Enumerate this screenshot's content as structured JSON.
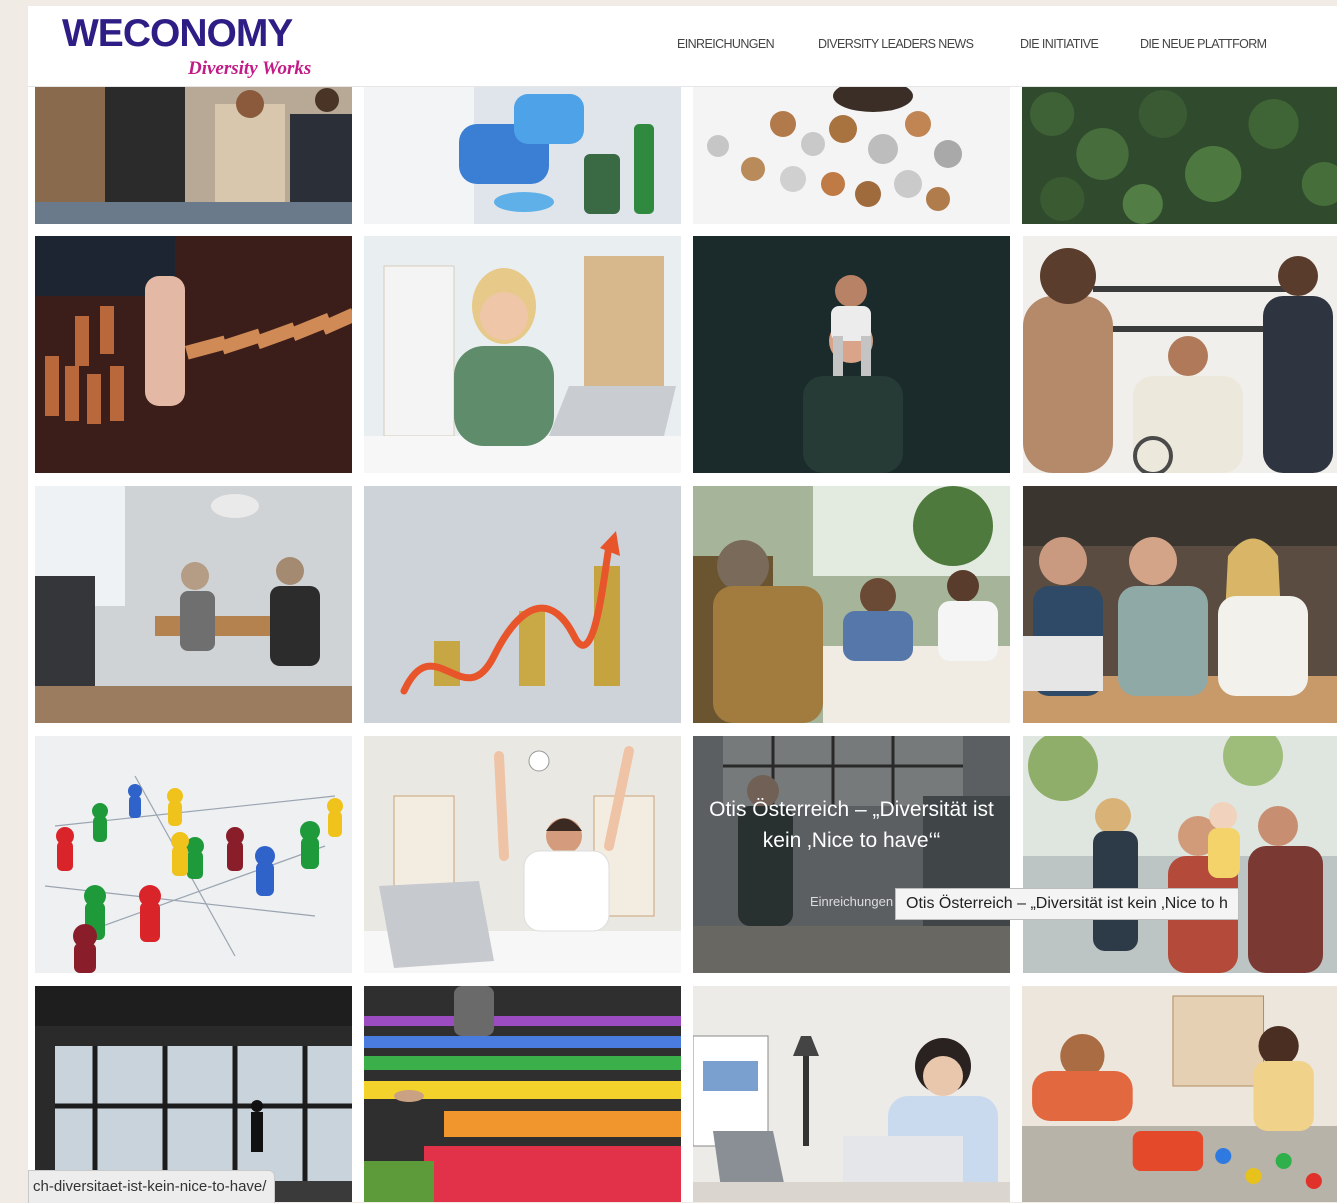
{
  "header": {
    "logo_main": "WECONOMY",
    "logo_sub": "Diversity Works",
    "nav": [
      "EINREICHUNGEN",
      "DIVERSITY LEADERS NEWS",
      "DIE INITIATIVE",
      "DIE NEUE PLATTFORM"
    ]
  },
  "hover_card": {
    "title": "Otis Österreich – „Diversität ist kein ‚Nice to have‘“",
    "category": "Einreichungen"
  },
  "tooltip": "Otis Österreich – „Diversität ist kein ‚Nice to h",
  "status_url": "ch-diversitaet-ist-kein-nice-to-have/",
  "colors": {
    "logo_blue": "#2f1d86",
    "logo_pink": "#c21a86",
    "page_background": "#f0ebe4"
  }
}
